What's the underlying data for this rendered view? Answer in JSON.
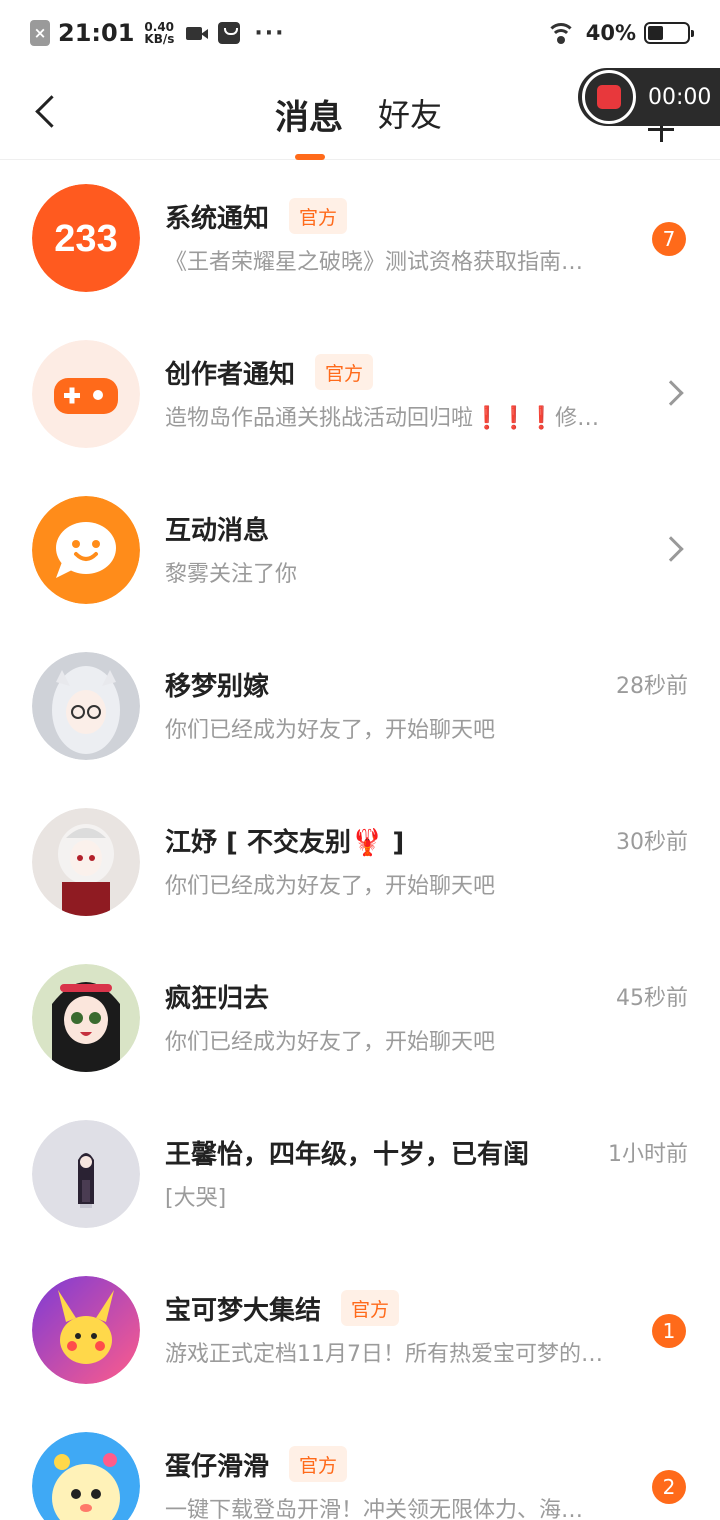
{
  "statusbar": {
    "time": "21:01",
    "speed_value": "0.40",
    "speed_unit": "KB/s",
    "dots": "···",
    "battery_text": "40%",
    "battery_level": 0.4
  },
  "header": {
    "tabs": [
      {
        "label": "消息",
        "active": true
      },
      {
        "label": "好友",
        "active": false
      }
    ]
  },
  "recorder": {
    "time": "00:00"
  },
  "colors": {
    "accent": "#ff6a1a",
    "badge_bg": "#fff0e6",
    "text_secondary": "#9b9b9b"
  },
  "messages": [
    {
      "name": "系统通知",
      "badge": "官方",
      "preview": "《王者荣耀星之破晓》测试资格获取指南…",
      "unread": "7",
      "avatar_icon": "233-logo-icon"
    },
    {
      "name": "创作者通知",
      "badge": "官方",
      "preview": "造物岛作品通关挑战活动回归啦❗❗❗修…",
      "avatar_icon": "gamepad-icon"
    },
    {
      "name": "互动消息",
      "preview": "黎雾关注了你",
      "avatar_icon": "chat-bubble-icon"
    },
    {
      "name": "移梦别嫁",
      "preview": "你们已经成为好友了，开始聊天吧",
      "time": "28秒前",
      "avatar_icon": "anime-avatar-icon"
    },
    {
      "name": "江妤 [ 不交友别🦞 ]",
      "preview": "你们已经成为好友了，开始聊天吧",
      "time": "30秒前",
      "avatar_icon": "anime-avatar-icon"
    },
    {
      "name": "疯狂归去",
      "preview": "你们已经成为好友了，开始聊天吧",
      "time": "45秒前",
      "avatar_icon": "anime-avatar-icon"
    },
    {
      "name": "王馨怡，四年级，十岁，已有闺",
      "preview": "[大哭]",
      "time": "1小时前",
      "avatar_icon": "anime-avatar-icon"
    },
    {
      "name": "宝可梦大集结",
      "badge": "官方",
      "preview": "游戏正式定档11月7日！所有热爱宝可梦的…",
      "unread": "1",
      "avatar_icon": "pikachu-icon"
    },
    {
      "name": "蛋仔滑滑",
      "badge": "官方",
      "preview": "一键下载登岛开滑！冲关领无限体力、海…",
      "unread": "2",
      "avatar_icon": "eggy-icon"
    }
  ]
}
